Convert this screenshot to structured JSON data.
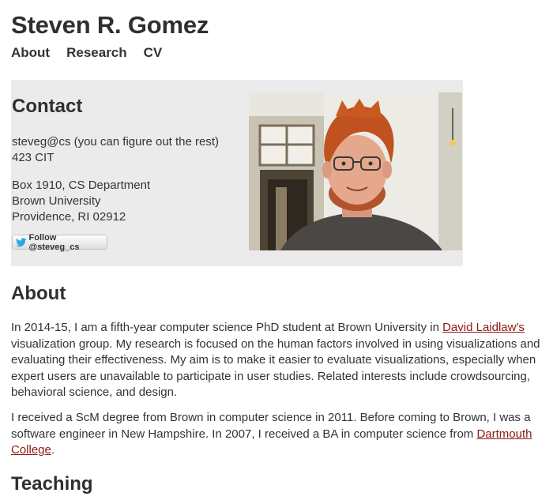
{
  "header": {
    "site_title": "Steven R. Gomez",
    "nav": [
      "About",
      "Research",
      "CV"
    ]
  },
  "contact": {
    "title": "Contact",
    "lines_group1": [
      "steveg@cs (you can figure out the rest)",
      "423 CIT"
    ],
    "lines_group2": [
      "Box 1910, CS Department",
      "Brown University",
      "Providence, RI 02912"
    ],
    "follow_label": "Follow @steveg_cs",
    "photo_icon": "profile-photo"
  },
  "about": {
    "title": "About",
    "p1": {
      "before": "In 2014-15, I am a fifth-year computer science PhD student at Brown University in ",
      "link": "David Laidlaw's",
      "after": " visualization group. My research is focused on the human factors involved in using visualizations and evaluating their effectiveness. My aim is to make it easier to evaluate visualizations, especially when expert users are unavailable to participate in user studies. Related interests include crowdsourcing, behavioral science, and design."
    },
    "p2": {
      "before": "I received a ScM degree from Brown in computer science in 2011. Before coming to Brown, I was a software engineer in New Hampshire. In 2007, I received a BA in computer science from ",
      "link": "Dartmouth College",
      "after": "."
    }
  },
  "teaching": {
    "title": "Teaching"
  },
  "colors": {
    "link": "#8b1a10",
    "contact_bg": "#ebebeb",
    "twitter": "#2aa9e0"
  }
}
